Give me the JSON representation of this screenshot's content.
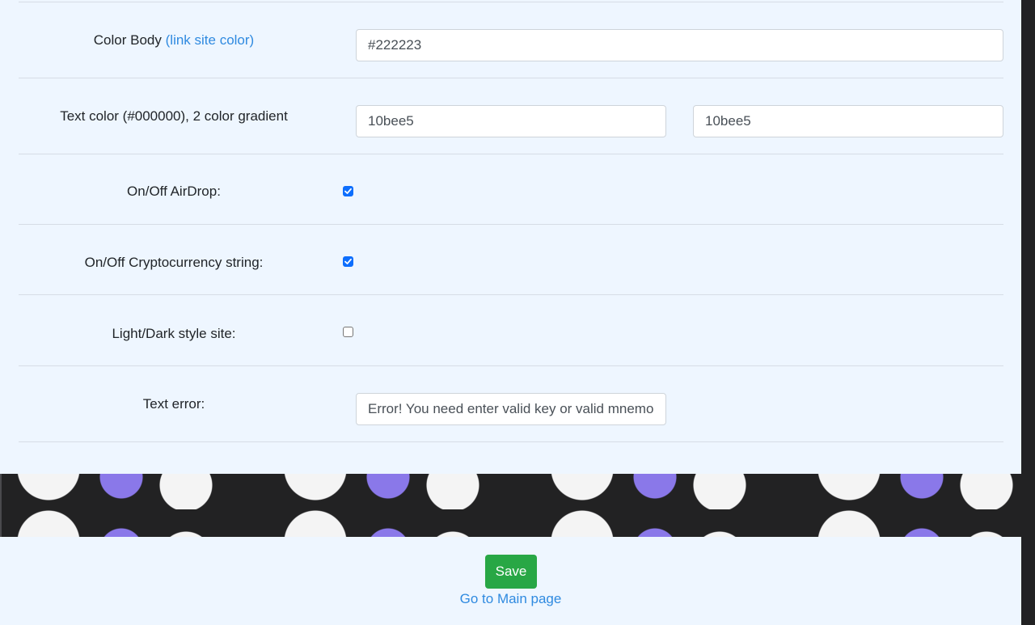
{
  "settings": {
    "color_body": {
      "label": "Color Body",
      "link_text": "(link site color)",
      "value": "#222223"
    },
    "text_color": {
      "label": "Text color (#000000), 2 color gradient",
      "value1": "10bee5",
      "value2": "10bee5"
    },
    "airdrop": {
      "label": "On/Off AirDrop:",
      "checked": true
    },
    "crypto_string": {
      "label": "On/Off Cryptocurrency string:",
      "checked": true
    },
    "light_dark": {
      "label": "Light/Dark style site:",
      "checked": false
    },
    "text_error": {
      "label": "Text error:",
      "value": "Error! You need enter valid key or valid mnemonic"
    }
  },
  "actions": {
    "save_label": "Save",
    "main_link_label": "Go to Main page"
  },
  "colors": {
    "panel_background": "#eef6ff",
    "page_background": "#222223",
    "link": "#2f8ae0",
    "save_button": "#28a745",
    "checkbox": "#0d6efd"
  }
}
